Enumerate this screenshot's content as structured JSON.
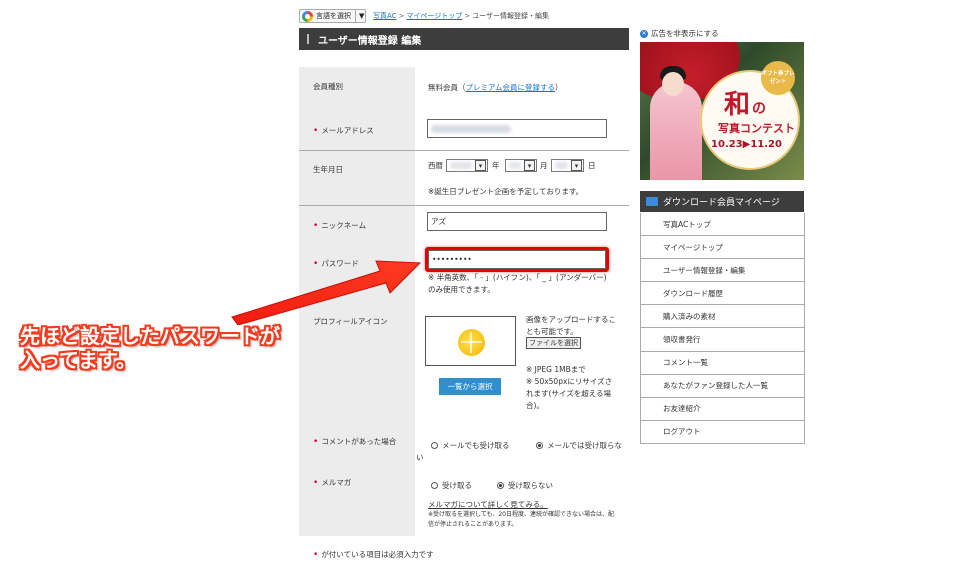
{
  "translate": {
    "label": "言語を選択",
    "arrow": "▼"
  },
  "breadcrumb": [
    {
      "label": "写真AC"
    },
    {
      "label": "マイページトップ"
    },
    {
      "label": "ユーザー情報登録・編集"
    }
  ],
  "breadcrumb_sep": ">",
  "page_title": "ユーザー情報登録 編集",
  "form": {
    "membership": {
      "label": "会員種別",
      "value": "無料会員（",
      "link": "プレミアム会員に登録する",
      "value_end": "）"
    },
    "email": {
      "label": "メールアドレス"
    },
    "birthday": {
      "label": "生年月日",
      "era": "西暦",
      "year": "年",
      "month": "月",
      "day": "日",
      "note": "※誕生日プレゼント企画を予定しております。"
    },
    "nickname": {
      "label": "ニックネーム",
      "value": "アズ"
    },
    "password": {
      "label": "パスワード",
      "value": "•••••••••",
      "note1": "※ 半角英数、「 - 」(ハイフン)、「 _ 」(アンダーバー)",
      "note2": "のみ使用できます。"
    },
    "profile_icon": {
      "label": "プロフィールアイコン",
      "upload_text1": "画像をアップロードするこ",
      "upload_text2": "とも可能です。",
      "file_button": "ファイルを選択",
      "choose_button": "一覧から選択",
      "spec1": "※ JPEG 1MBまで",
      "spec2": "※ 50x50pxにリサイズさ",
      "spec3": "れます(サイズを超える場",
      "spec4": "合)。"
    },
    "comment_notify": {
      "label": "コメントがあった場合",
      "option1": "メールでも受け取る",
      "option2": "メールでは受け取らな",
      "option2_wrap": "い",
      "selected": "option2"
    },
    "mailmag": {
      "label": "メルマガ",
      "option1": "受け取る",
      "option2": "受け取らない",
      "selected": "option2",
      "link": "メルマガについて詳しく見てみる。",
      "note1": "※受け取るを選択しても、20日程度、連続が確認できない場合は、配",
      "note2": "信が停止されることがあります。"
    },
    "required_note": "が付いている項目は必須入力です",
    "required_mark": "•"
  },
  "sidebar": {
    "hide_ad": "広告を非表示にする",
    "banner": {
      "gift": "ギフト券プレゼント",
      "big": "和",
      "no": "の",
      "sub": "写真コンテスト",
      "date": "10.23▶11.20"
    },
    "menu_title": "ダウンロード会員マイページ",
    "menu": [
      "写真ACトップ",
      "マイページトップ",
      "ユーザー情報登録・編集",
      "ダウンロード履歴",
      "購入済みの素材",
      "領収書発行",
      "コメント一覧",
      "あなたがファン登録した人一覧",
      "お友達紹介",
      "ログアウト"
    ]
  },
  "annotation": {
    "line1": "先ほど設定したパスワードが",
    "line2": "入ってます。"
  },
  "colors": {
    "title_bar": "#3d3d3d",
    "accent_blue": "#2f8fcf",
    "required_red": "#d9001b",
    "highlight_red": "#e60000",
    "callout": "#f23b1f"
  }
}
